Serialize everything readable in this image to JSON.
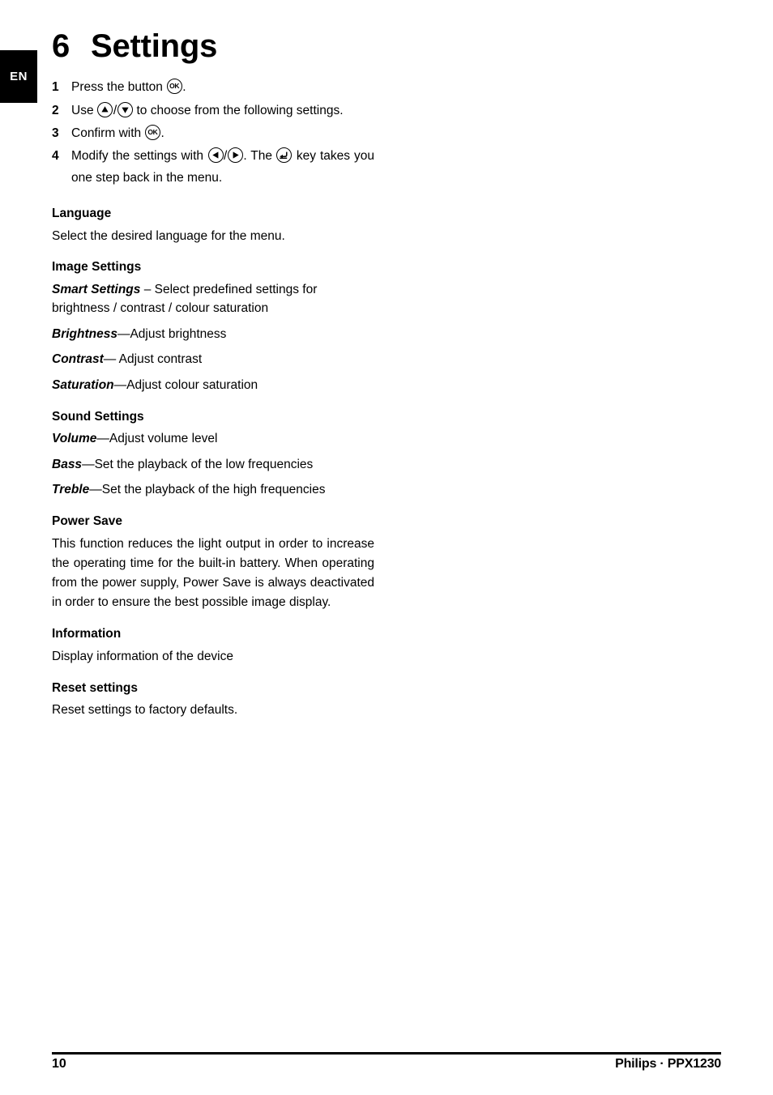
{
  "language_tab": {
    "label": "EN"
  },
  "chapter": {
    "number": "6",
    "title": "Settings"
  },
  "steps": [
    {
      "index": "1",
      "parts": [
        {
          "type": "text",
          "value": "Press the button "
        },
        {
          "type": "icon",
          "icon": "ok-key-icon"
        },
        {
          "type": "text",
          "value": "."
        }
      ]
    },
    {
      "index": "2",
      "parts": [
        {
          "type": "text",
          "value": "Use "
        },
        {
          "type": "icon",
          "icon": "up-key-icon"
        },
        {
          "type": "text",
          "value": "/"
        },
        {
          "type": "icon",
          "icon": "down-key-icon"
        },
        {
          "type": "text",
          "value": " to choose from the following settings."
        }
      ]
    },
    {
      "index": "3",
      "parts": [
        {
          "type": "text",
          "value": "Confirm with "
        },
        {
          "type": "icon",
          "icon": "ok-key-icon"
        },
        {
          "type": "text",
          "value": "."
        }
      ]
    },
    {
      "index": "4",
      "parts": [
        {
          "type": "text",
          "value": "Modify the settings with "
        },
        {
          "type": "icon",
          "icon": "left-key-icon"
        },
        {
          "type": "text",
          "value": "/"
        },
        {
          "type": "icon",
          "icon": "right-key-icon"
        },
        {
          "type": "text",
          "value": ". The "
        },
        {
          "type": "icon",
          "icon": "back-key-icon"
        },
        {
          "type": "text",
          "value": " key takes you one step back in the menu."
        }
      ]
    }
  ],
  "sections": [
    {
      "heading": "Language",
      "paragraphs": [
        {
          "term": "",
          "text": "Select the desired language for the menu."
        }
      ]
    },
    {
      "heading": "Image Settings",
      "paragraphs": [
        {
          "term": "Smart Settings",
          "text": " – Select predefined settings for brightness / contrast / colour saturation"
        },
        {
          "term": "Brightness",
          "text": "—Adjust brightness"
        },
        {
          "term": "Contrast",
          "text": "— Adjust contrast"
        },
        {
          "term": "Saturation",
          "text": "—Adjust colour saturation"
        }
      ]
    },
    {
      "heading": "Sound Settings",
      "paragraphs": [
        {
          "term": "Volume",
          "text": "—Adjust volume level"
        },
        {
          "term": "Bass",
          "text": "—Set the playback of the low frequencies"
        },
        {
          "term": "Treble",
          "text": "—Set the playback of the high frequencies"
        }
      ]
    },
    {
      "heading": "Power Save",
      "justified": "This function reduces the light output in order to increase the operating time for the built-in battery. When operating from the power supply, Power Save is always deactivated in order to ensure the best possible image display."
    },
    {
      "heading": "Information",
      "paragraphs": [
        {
          "term": "",
          "text": "Display information of the device"
        }
      ]
    },
    {
      "heading": "Reset settings",
      "paragraphs": [
        {
          "term": "",
          "text": "Reset settings to factory defaults."
        }
      ]
    }
  ],
  "footer": {
    "page_number": "10",
    "brand": "Philips · PPX1230"
  }
}
